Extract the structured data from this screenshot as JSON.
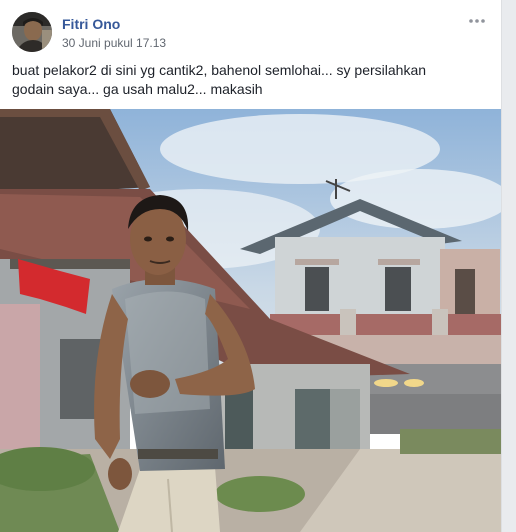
{
  "post": {
    "author_name": "Fitri Ono",
    "timestamp": "30 Juni pukul 17.13",
    "text": "buat pelakor2 di sini yg cantik2, bahenol semlohai... sy persilahkan\ngodain saya... ga usah malu2... makasih",
    "more_icon": "ellipsis-icon",
    "avatar_icon": "profile-avatar"
  },
  "colors": {
    "author_link": "#365899",
    "timestamp": "#616770",
    "body_text": "#1d2129",
    "page_background": "#e9ebee"
  }
}
